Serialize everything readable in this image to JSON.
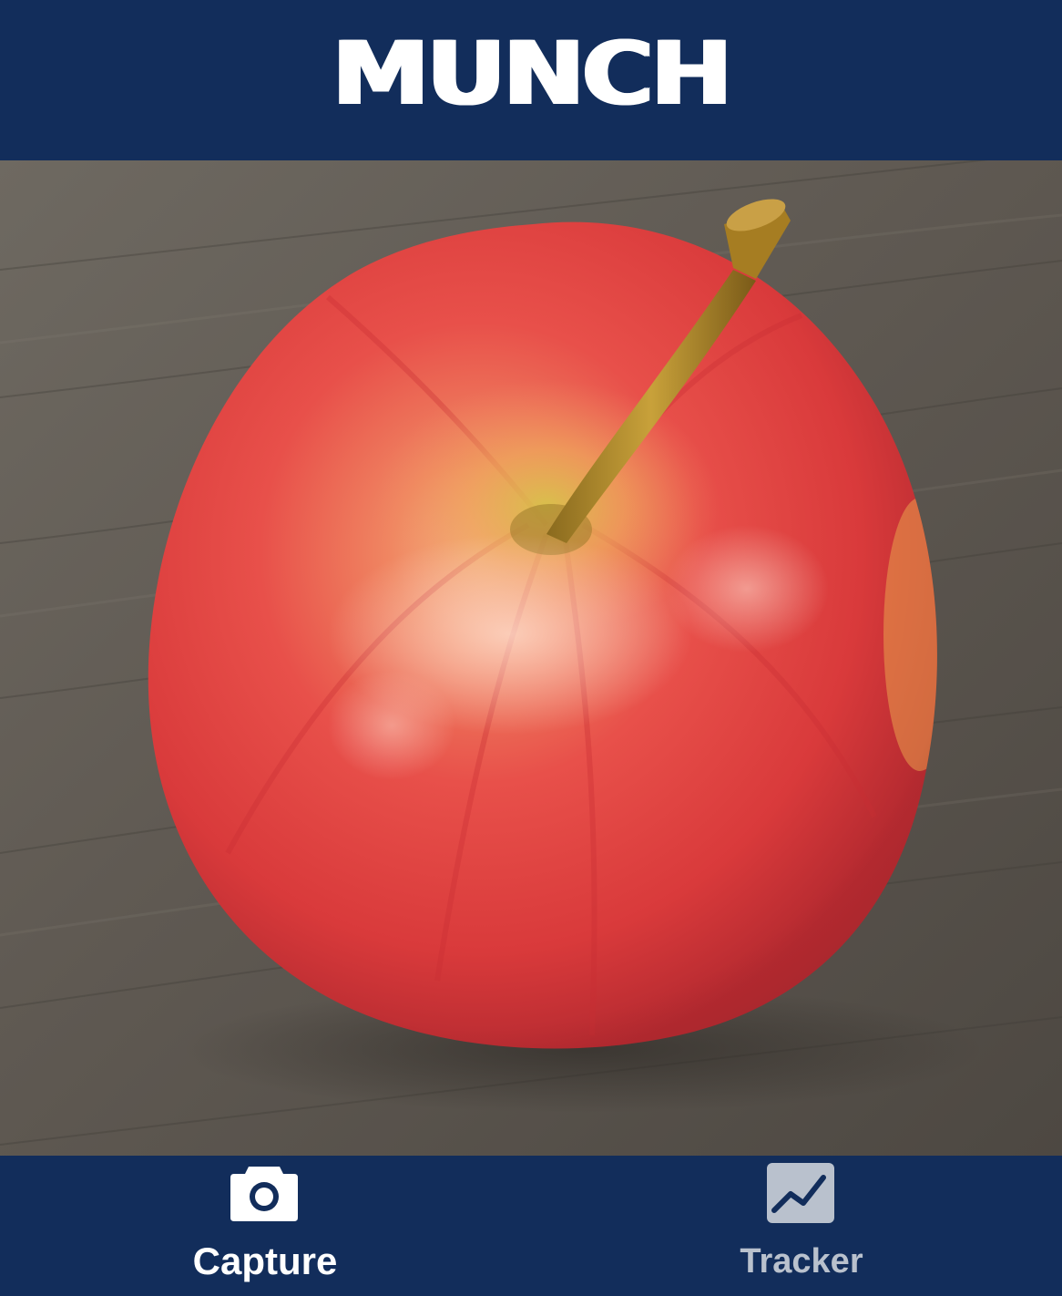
{
  "app": {
    "title": "MUNCH"
  },
  "photo": {
    "subject": "apple"
  },
  "tabs": [
    {
      "label": "Capture",
      "icon": "camera-icon",
      "active": true
    },
    {
      "label": "Tracker",
      "icon": "trend-chart-icon",
      "active": false
    }
  ],
  "colors": {
    "navy": "#122d5b",
    "active_text": "#ffffff",
    "inactive_text": "#b9c1cd"
  }
}
